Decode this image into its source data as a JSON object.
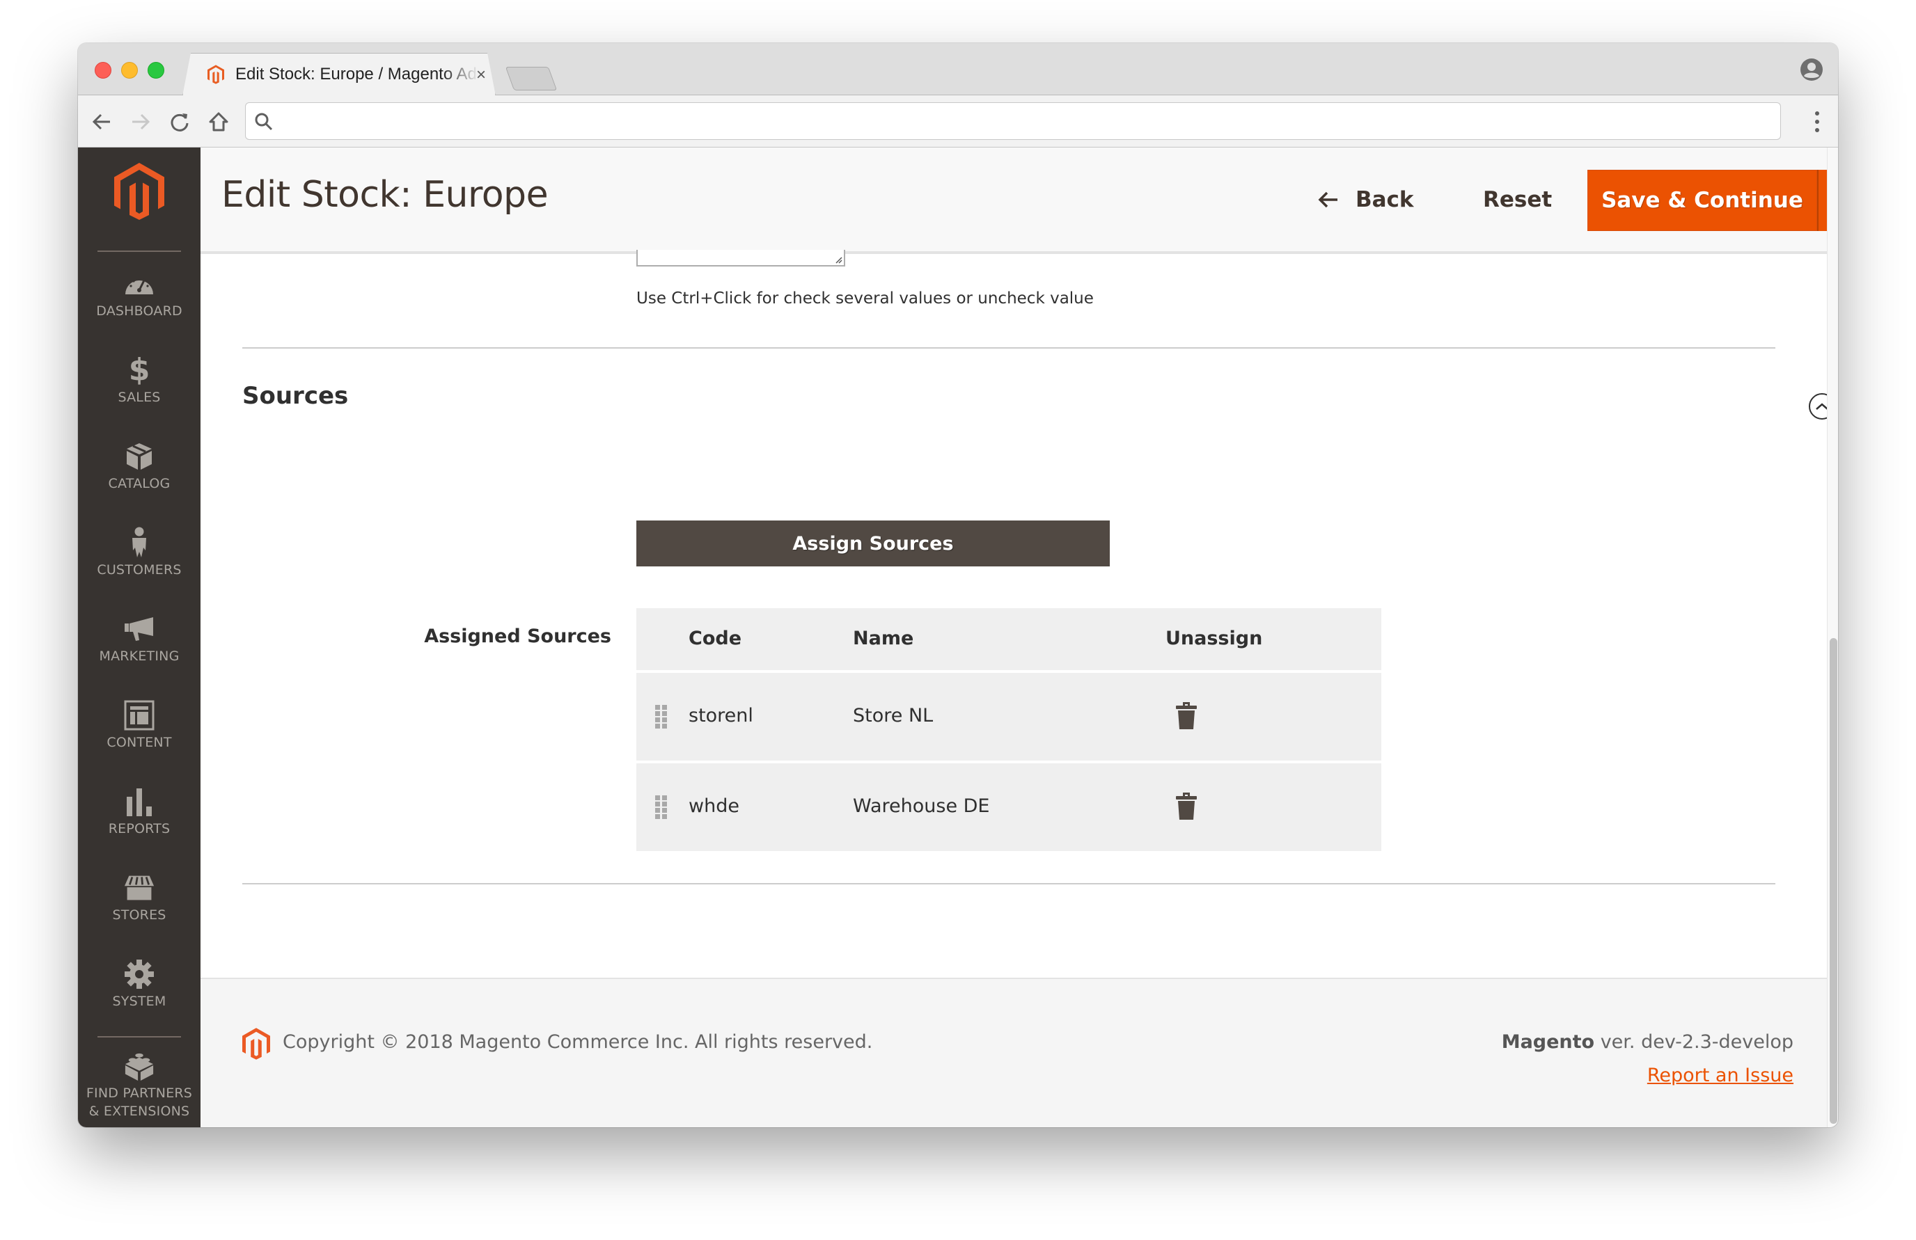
{
  "browser": {
    "tab_title": "Edit Stock: Europe / Magento Admin",
    "tab_close": "×",
    "address_value": "",
    "address_placeholder": "",
    "icons": {
      "back": "arrow-left-icon",
      "forward": "arrow-right-icon",
      "reload": "reload-icon",
      "home": "home-icon",
      "search": "search-icon",
      "profile": "profile-icon",
      "menu": "more-vertical-icon"
    }
  },
  "sidebar": {
    "items": [
      {
        "label": "DASHBOARD",
        "icon": "dashboard-gauge-icon"
      },
      {
        "label": "SALES",
        "icon": "dollar-icon"
      },
      {
        "label": "CATALOG",
        "icon": "box-icon"
      },
      {
        "label": "CUSTOMERS",
        "icon": "person-icon"
      },
      {
        "label": "MARKETING",
        "icon": "megaphone-icon"
      },
      {
        "label": "CONTENT",
        "icon": "layout-icon"
      },
      {
        "label": "REPORTS",
        "icon": "bar-chart-icon"
      },
      {
        "label": "STORES",
        "icon": "storefront-icon"
      },
      {
        "label": "SYSTEM",
        "icon": "gear-icon"
      }
    ],
    "partners": {
      "label_line1": "FIND PARTNERS",
      "label_line2": "& EXTENSIONS",
      "icon": "lego-brick-icon"
    }
  },
  "header": {
    "title": "Edit Stock: Europe",
    "back_label": "Back",
    "reset_label": "Reset",
    "save_label": "Save & Continue"
  },
  "form": {
    "hint": "Use Ctrl+Click for check several values or uncheck value",
    "section_title": "Sources",
    "assign_button": "Assign Sources",
    "assigned_label": "Assigned Sources",
    "table": {
      "columns": [
        "Code",
        "Name",
        "Unassign"
      ],
      "rows": [
        {
          "code": "storenl",
          "name": "Store NL"
        },
        {
          "code": "whde",
          "name": "Warehouse DE"
        }
      ]
    }
  },
  "footer": {
    "copyright": "Copyright © 2018 Magento Commerce Inc. All rights reserved.",
    "brand": "Magento",
    "version": " ver. dev-2.3-develop",
    "report_link": "Report an Issue"
  },
  "colors": {
    "accent": "#eb5202",
    "sidebar_bg": "#373330",
    "dark_button": "#514943",
    "text": "#303030",
    "table_bg": "#efefef"
  }
}
